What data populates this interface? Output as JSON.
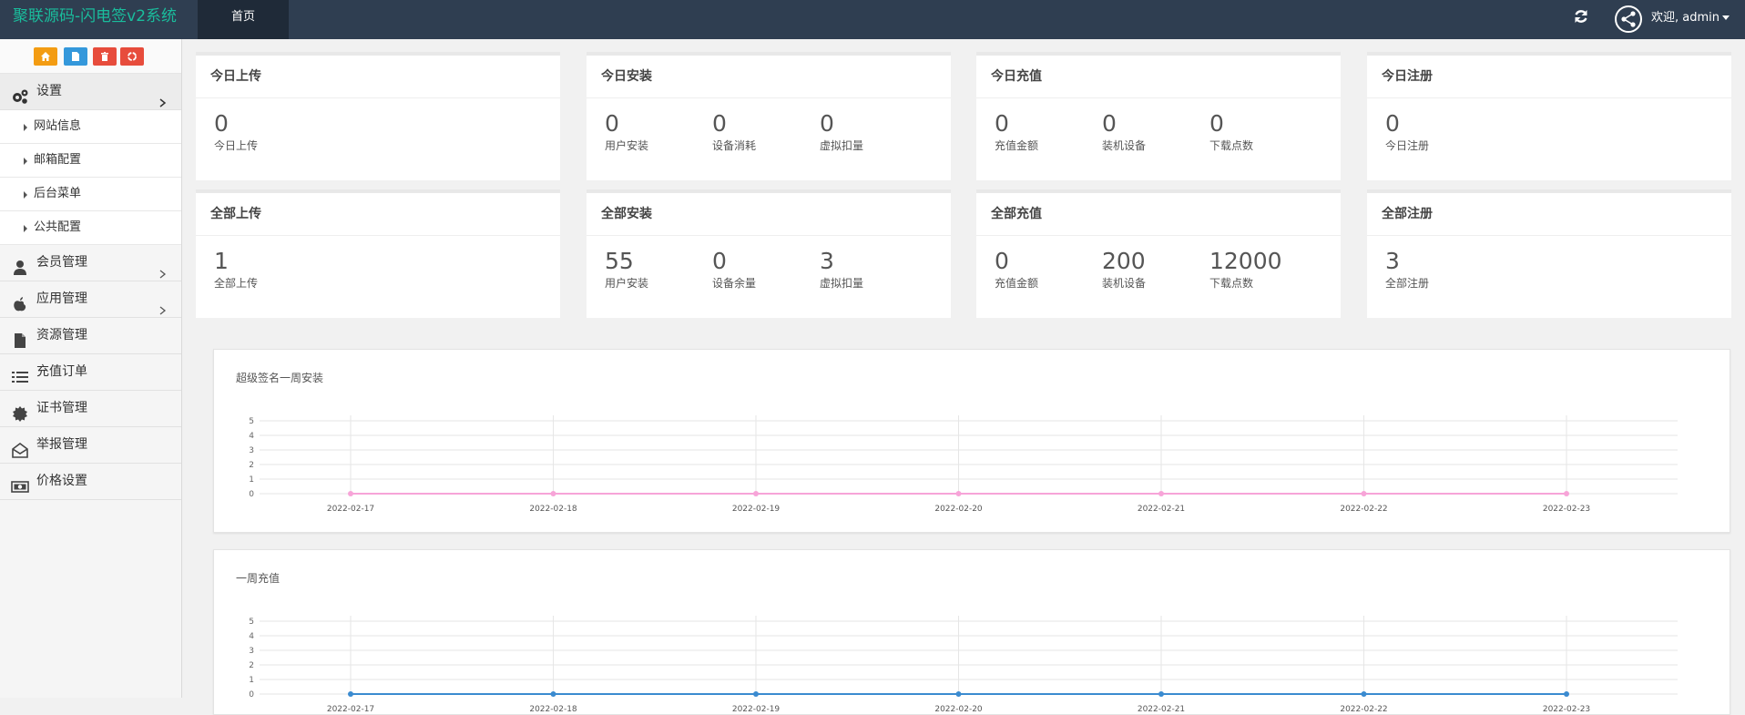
{
  "topbar": {
    "brand": "聚联源码-闪电签v2系统",
    "home_tab": "首页",
    "user_text": "欢迎, admin",
    "refresh_icon": "refresh-icon",
    "avatar_icon": "share-avatar-icon"
  },
  "sidebar": {
    "quick_buttons": [
      {
        "icon": "home-icon",
        "color": "#f39c12"
      },
      {
        "icon": "file-icon",
        "color": "#3498db"
      },
      {
        "icon": "trash-icon",
        "color": "#e74c3c"
      },
      {
        "icon": "recycle-icon",
        "color": "#e74c3c"
      }
    ],
    "settings": {
      "label": "设置",
      "icon": "gears-icon",
      "sub": [
        "网站信息",
        "邮箱配置",
        "后台菜单",
        "公共配置"
      ]
    },
    "items": [
      {
        "label": "会员管理",
        "icon": "user-icon",
        "chevron": true
      },
      {
        "label": "应用管理",
        "icon": "apple-icon",
        "chevron": true
      },
      {
        "label": "资源管理",
        "icon": "file-icon",
        "chevron": false
      },
      {
        "label": "充值订单",
        "icon": "list-icon",
        "chevron": false
      },
      {
        "label": "证书管理",
        "icon": "certificate-icon",
        "chevron": false
      },
      {
        "label": "举报管理",
        "icon": "envelope-open-icon",
        "chevron": false
      },
      {
        "label": "价格设置",
        "icon": "money-icon",
        "chevron": false
      }
    ]
  },
  "cards": [
    {
      "title": "今日上传",
      "stats": [
        {
          "value": "0",
          "label": "今日上传"
        }
      ]
    },
    {
      "title": "今日安装",
      "stats": [
        {
          "value": "0",
          "label": "用户安装"
        },
        {
          "value": "0",
          "label": "设备消耗"
        },
        {
          "value": "0",
          "label": "虚拟扣量"
        }
      ]
    },
    {
      "title": "今日充值",
      "stats": [
        {
          "value": "0",
          "label": "充值金额"
        },
        {
          "value": "0",
          "label": "装机设备"
        },
        {
          "value": "0",
          "label": "下载点数"
        }
      ]
    },
    {
      "title": "今日注册",
      "stats": [
        {
          "value": "0",
          "label": "今日注册"
        }
      ]
    },
    {
      "title": "全部上传",
      "stats": [
        {
          "value": "1",
          "label": "全部上传"
        }
      ]
    },
    {
      "title": "全部安装",
      "stats": [
        {
          "value": "55",
          "label": "用户安装"
        },
        {
          "value": "0",
          "label": "设备余量"
        },
        {
          "value": "3",
          "label": "虚拟扣量"
        }
      ]
    },
    {
      "title": "全部充值",
      "stats": [
        {
          "value": "0",
          "label": "充值金额"
        },
        {
          "value": "200",
          "label": "装机设备"
        },
        {
          "value": "12000",
          "label": "下载点数"
        }
      ]
    },
    {
      "title": "全部注册",
      "stats": [
        {
          "value": "3",
          "label": "全部注册"
        }
      ]
    }
  ],
  "chart_data": [
    {
      "type": "line",
      "title": "超级签名一周安装",
      "categories": [
        "2022-02-17",
        "2022-02-18",
        "2022-02-19",
        "2022-02-20",
        "2022-02-21",
        "2022-02-22",
        "2022-02-23"
      ],
      "series": [
        {
          "values": [
            0,
            0,
            0,
            0,
            0,
            0,
            0
          ],
          "color": "#f7a4d8"
        }
      ],
      "ylim": [
        0,
        5
      ],
      "yticks": [
        0,
        1,
        2,
        3,
        4,
        5
      ],
      "grid": true
    },
    {
      "type": "line",
      "title": "一周充值",
      "categories": [
        "2022-02-17",
        "2022-02-18",
        "2022-02-19",
        "2022-02-20",
        "2022-02-21",
        "2022-02-22",
        "2022-02-23"
      ],
      "series": [
        {
          "values": [
            0,
            0,
            0,
            0,
            0,
            0,
            0
          ],
          "color": "#3b8bd0"
        }
      ],
      "ylim": [
        0,
        5
      ],
      "yticks": [
        0,
        1,
        2,
        3,
        4,
        5
      ],
      "grid": true
    }
  ]
}
